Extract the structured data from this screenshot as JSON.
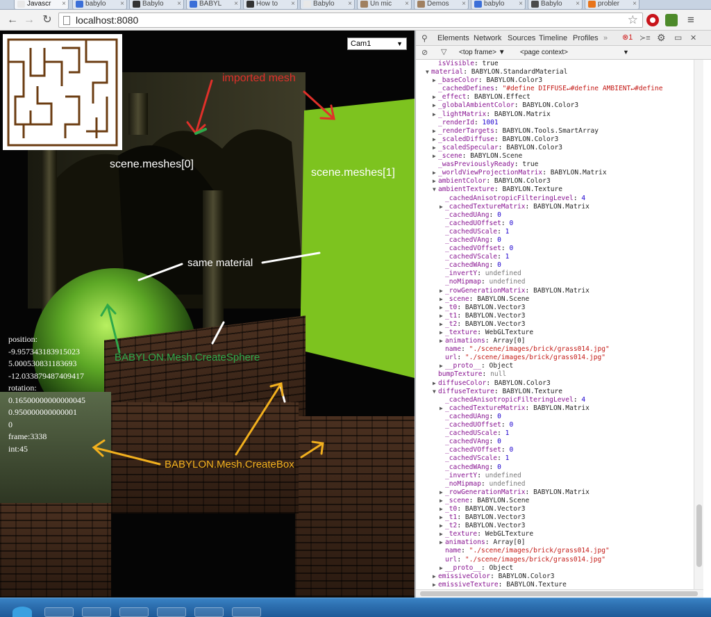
{
  "browser": {
    "tabs": [
      {
        "label": "Javascr",
        "fav_color": "#e8e8e8",
        "active": true
      },
      {
        "label": "babylo",
        "fav_color": "#3b6fd8",
        "active": false
      },
      {
        "label": "Babylo",
        "fav_color": "#333333",
        "active": false
      },
      {
        "label": "BABYL",
        "fav_color": "#3b6fd8",
        "active": false
      },
      {
        "label": "How to",
        "fav_color": "#333333",
        "active": false
      },
      {
        "label": "Babylo",
        "fav_color": "#e8e8e8",
        "active": false
      },
      {
        "label": "Un mic",
        "fav_color": "#a08060",
        "active": false
      },
      {
        "label": "Demos",
        "fav_color": "#a08060",
        "active": false
      },
      {
        "label": "babylo",
        "fav_color": "#3b6fd8",
        "active": false
      },
      {
        "label": "Babylo",
        "fav_color": "#4a4a4a",
        "active": false
      },
      {
        "label": "probler",
        "fav_color": "#e8741a",
        "active": false
      }
    ],
    "address": "localhost:8080"
  },
  "scene": {
    "camera_select": "Cam1",
    "annotations": {
      "imported_mesh": "imported mesh",
      "mesh0": "scene.meshes[0]",
      "mesh1": "scene.meshes[1]",
      "same_material": "same material",
      "create_sphere": "BABYLON.Mesh.CreateSphere",
      "create_box": "BABYLON.Mesh.CreateBox"
    },
    "stats": [
      "position:",
      "-9.957343183915023",
      "5.000530831183693",
      "-12.033879487409417",
      "rotation:",
      "0.16500000000000045",
      "0.950000000000001",
      "0",
      "frame:3338",
      "int:45"
    ]
  },
  "devtools": {
    "tabs": [
      "Elements",
      "Network",
      "Sources",
      "Timeline",
      "Profiles",
      "»"
    ],
    "error_count": "1",
    "context": {
      "frame": "<top frame>",
      "page": "<page context>"
    },
    "tree": [
      {
        "i": 2,
        "t": "",
        "k": "isVisible",
        "v": "true",
        "c": "kw"
      },
      {
        "i": 1,
        "t": "▼",
        "k": "material",
        "v": "BABYLON.StandardMaterial",
        "c": "obj"
      },
      {
        "i": 2,
        "t": "▶",
        "k": "_baseColor",
        "v": "BABYLON.Color3",
        "c": "obj"
      },
      {
        "i": 2,
        "t": "",
        "k": "_cachedDefines",
        "v": "\"#define DIFFUSE↵#define AMBIENT↵#define",
        "c": "str"
      },
      {
        "i": 2,
        "t": "▶",
        "k": "_effect",
        "v": "BABYLON.Effect",
        "c": "obj"
      },
      {
        "i": 2,
        "t": "▶",
        "k": "_globalAmbientColor",
        "v": "BABYLON.Color3",
        "c": "obj"
      },
      {
        "i": 2,
        "t": "▶",
        "k": "_lightMatrix",
        "v": "BABYLON.Matrix",
        "c": "obj"
      },
      {
        "i": 2,
        "t": "",
        "k": "_renderId",
        "v": "1001",
        "c": "num"
      },
      {
        "i": 2,
        "t": "▶",
        "k": "_renderTargets",
        "v": "BABYLON.Tools.SmartArray",
        "c": "obj"
      },
      {
        "i": 2,
        "t": "▶",
        "k": "_scaledDiffuse",
        "v": "BABYLON.Color3",
        "c": "obj"
      },
      {
        "i": 2,
        "t": "▶",
        "k": "_scaledSpecular",
        "v": "BABYLON.Color3",
        "c": "obj"
      },
      {
        "i": 2,
        "t": "▶",
        "k": "_scene",
        "v": "BABYLON.Scene",
        "c": "obj"
      },
      {
        "i": 2,
        "t": "",
        "k": "_wasPreviouslyReady",
        "v": "true",
        "c": "kw"
      },
      {
        "i": 2,
        "t": "▶",
        "k": "_worldViewProjectionMatrix",
        "v": "BABYLON.Matrix",
        "c": "obj"
      },
      {
        "i": 2,
        "t": "▶",
        "k": "ambientColor",
        "v": "BABYLON.Color3",
        "c": "obj"
      },
      {
        "i": 2,
        "t": "▼",
        "k": "ambientTexture",
        "v": "BABYLON.Texture",
        "c": "obj"
      },
      {
        "i": 3,
        "t": "",
        "k": "_cachedAnisotropicFilteringLevel",
        "v": "4",
        "c": "num"
      },
      {
        "i": 3,
        "t": "▶",
        "k": "_cachedTextureMatrix",
        "v": "BABYLON.Matrix",
        "c": "obj"
      },
      {
        "i": 3,
        "t": "",
        "k": "_cachedUAng",
        "v": "0",
        "c": "num"
      },
      {
        "i": 3,
        "t": "",
        "k": "_cachedUOffset",
        "v": "0",
        "c": "num"
      },
      {
        "i": 3,
        "t": "",
        "k": "_cachedUScale",
        "v": "1",
        "c": "num"
      },
      {
        "i": 3,
        "t": "",
        "k": "_cachedVAng",
        "v": "0",
        "c": "num"
      },
      {
        "i": 3,
        "t": "",
        "k": "_cachedVOffset",
        "v": "0",
        "c": "num"
      },
      {
        "i": 3,
        "t": "",
        "k": "_cachedVScale",
        "v": "1",
        "c": "num"
      },
      {
        "i": 3,
        "t": "",
        "k": "_cachedWAng",
        "v": "0",
        "c": "num"
      },
      {
        "i": 3,
        "t": "",
        "k": "_invertY",
        "v": "undefined",
        "c": "undef"
      },
      {
        "i": 3,
        "t": "",
        "k": "_noMipmap",
        "v": "undefined",
        "c": "undef"
      },
      {
        "i": 3,
        "t": "▶",
        "k": "_rowGenerationMatrix",
        "v": "BABYLON.Matrix",
        "c": "obj"
      },
      {
        "i": 3,
        "t": "▶",
        "k": "_scene",
        "v": "BABYLON.Scene",
        "c": "obj"
      },
      {
        "i": 3,
        "t": "▶",
        "k": "_t0",
        "v": "BABYLON.Vector3",
        "c": "obj"
      },
      {
        "i": 3,
        "t": "▶",
        "k": "_t1",
        "v": "BABYLON.Vector3",
        "c": "obj"
      },
      {
        "i": 3,
        "t": "▶",
        "k": "_t2",
        "v": "BABYLON.Vector3",
        "c": "obj"
      },
      {
        "i": 3,
        "t": "▶",
        "k": "_texture",
        "v": "WebGLTexture",
        "c": "obj"
      },
      {
        "i": 3,
        "t": "▶",
        "k": "animations",
        "v": "Array[0]",
        "c": "obj"
      },
      {
        "i": 3,
        "t": "",
        "k": "name",
        "v": "\"./scene/images/brick/grass014.jpg\"",
        "c": "str"
      },
      {
        "i": 3,
        "t": "",
        "k": "url",
        "v": "\"./scene/images/brick/grass014.jpg\"",
        "c": "str"
      },
      {
        "i": 3,
        "t": "▶",
        "k": "__proto__",
        "v": "Object",
        "c": "obj"
      },
      {
        "i": 2,
        "t": "",
        "k": "bumpTexture",
        "v": "null",
        "c": "undef"
      },
      {
        "i": 2,
        "t": "▶",
        "k": "diffuseColor",
        "v": "BABYLON.Color3",
        "c": "obj"
      },
      {
        "i": 2,
        "t": "▼",
        "k": "diffuseTexture",
        "v": "BABYLON.Texture",
        "c": "obj"
      },
      {
        "i": 3,
        "t": "",
        "k": "_cachedAnisotropicFilteringLevel",
        "v": "4",
        "c": "num"
      },
      {
        "i": 3,
        "t": "▶",
        "k": "_cachedTextureMatrix",
        "v": "BABYLON.Matrix",
        "c": "obj"
      },
      {
        "i": 3,
        "t": "",
        "k": "_cachedUAng",
        "v": "0",
        "c": "num"
      },
      {
        "i": 3,
        "t": "",
        "k": "_cachedUOffset",
        "v": "0",
        "c": "num"
      },
      {
        "i": 3,
        "t": "",
        "k": "_cachedUScale",
        "v": "1",
        "c": "num"
      },
      {
        "i": 3,
        "t": "",
        "k": "_cachedVAng",
        "v": "0",
        "c": "num"
      },
      {
        "i": 3,
        "t": "",
        "k": "_cachedVOffset",
        "v": "0",
        "c": "num"
      },
      {
        "i": 3,
        "t": "",
        "k": "_cachedVScale",
        "v": "1",
        "c": "num"
      },
      {
        "i": 3,
        "t": "",
        "k": "_cachedWAng",
        "v": "0",
        "c": "num"
      },
      {
        "i": 3,
        "t": "",
        "k": "_invertY",
        "v": "undefined",
        "c": "undef"
      },
      {
        "i": 3,
        "t": "",
        "k": "_noMipmap",
        "v": "undefined",
        "c": "undef"
      },
      {
        "i": 3,
        "t": "▶",
        "k": "_rowGenerationMatrix",
        "v": "BABYLON.Matrix",
        "c": "obj"
      },
      {
        "i": 3,
        "t": "▶",
        "k": "_scene",
        "v": "BABYLON.Scene",
        "c": "obj"
      },
      {
        "i": 3,
        "t": "▶",
        "k": "_t0",
        "v": "BABYLON.Vector3",
        "c": "obj"
      },
      {
        "i": 3,
        "t": "▶",
        "k": "_t1",
        "v": "BABYLON.Vector3",
        "c": "obj"
      },
      {
        "i": 3,
        "t": "▶",
        "k": "_t2",
        "v": "BABYLON.Vector3",
        "c": "obj"
      },
      {
        "i": 3,
        "t": "▶",
        "k": "_texture",
        "v": "WebGLTexture",
        "c": "obj"
      },
      {
        "i": 3,
        "t": "▶",
        "k": "animations",
        "v": "Array[0]",
        "c": "obj"
      },
      {
        "i": 3,
        "t": "",
        "k": "name",
        "v": "\"./scene/images/brick/grass014.jpg\"",
        "c": "str"
      },
      {
        "i": 3,
        "t": "",
        "k": "url",
        "v": "\"./scene/images/brick/grass014.jpg\"",
        "c": "str"
      },
      {
        "i": 3,
        "t": "▶",
        "k": "__proto__",
        "v": "Object",
        "c": "obj"
      },
      {
        "i": 2,
        "t": "▶",
        "k": "emissiveColor",
        "v": "BABYLON.Color3",
        "c": "obj"
      },
      {
        "i": 2,
        "t": "▶",
        "k": "emissiveTexture",
        "v": "BABYLON.Texture",
        "c": "obj"
      }
    ]
  },
  "colors": {
    "annotation_red": "#e0302a",
    "annotation_green": "#2ea84a",
    "annotation_orange": "#f2b01e",
    "annotation_white": "#ffffff",
    "green_wall": "#7dc31f"
  }
}
